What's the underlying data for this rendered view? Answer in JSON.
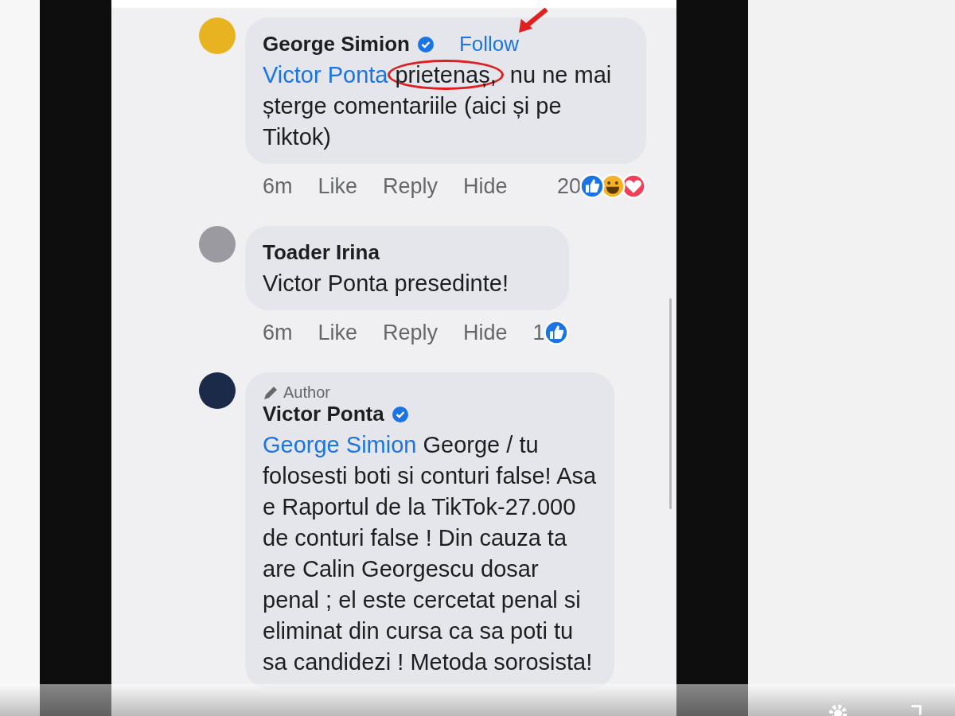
{
  "comments": [
    {
      "author": "George Simion",
      "verified": true,
      "follow": "Follow",
      "mention": "Victor Ponta",
      "circled": "prietenaș,",
      "text": " nu ne mai șterge comentariile (aici și pe Tiktok)",
      "time": "6m",
      "actions": [
        "Like",
        "Reply",
        "Hide"
      ],
      "reaction_count": "20",
      "reactions": [
        {
          "kind": "like"
        },
        {
          "kind": "haha"
        },
        {
          "kind": "love"
        }
      ]
    },
    {
      "author": "Toader Irina",
      "verified": false,
      "text": "Victor Ponta presedinte!",
      "time": "6m",
      "actions": [
        "Like",
        "Reply",
        "Hide"
      ],
      "reaction_count": "1",
      "reactions": [
        {
          "kind": "like"
        }
      ]
    },
    {
      "author": "Victor Ponta",
      "verified": true,
      "badge": "Author",
      "mention": "George Simion",
      "text": " George / tu folosesti boti si conturi false! Asa e Raportul de la TikTok-27.000 de conturi false ! Din cauza ta are Calin Georgescu dosar penal ; el este cercetat penal si eliminat din cursa ca sa poti tu sa candidezi ! Metoda sorosista!"
    }
  ]
}
